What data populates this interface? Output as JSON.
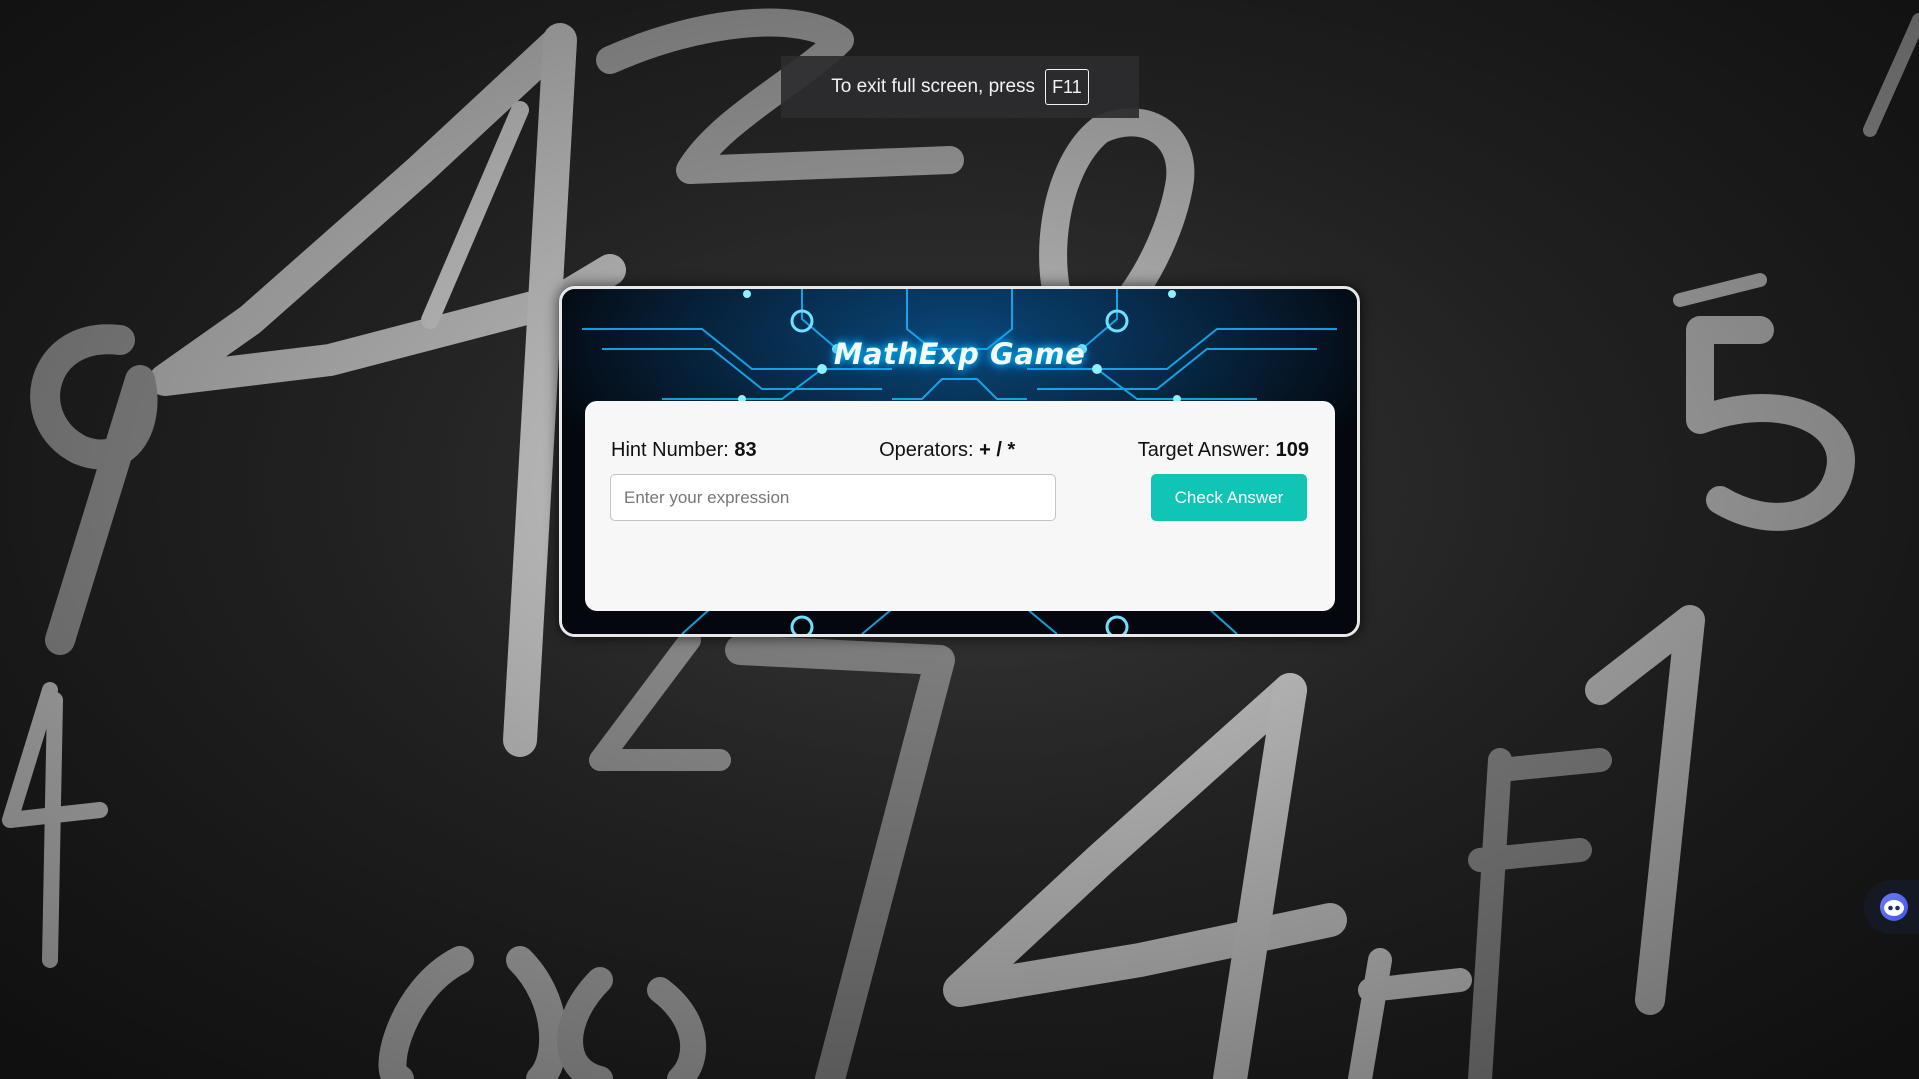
{
  "fullscreen_notice": {
    "text": "To exit full screen, press",
    "key": "F11"
  },
  "game": {
    "title": "MathExp Game",
    "hint_label": "Hint Number:",
    "hint_value": "83",
    "operators_label": "Operators:",
    "operators_value": "+ / *",
    "target_label": "Target Answer:",
    "target_value": "109",
    "input_placeholder": "Enter your expression",
    "input_value": "",
    "check_button_label": "Check Answer"
  },
  "background": {
    "decorative_digits": [
      "4",
      "2",
      "0",
      "9",
      "4",
      "4",
      "5",
      "4",
      "1",
      "0",
      "9",
      "7",
      "4",
      "5"
    ]
  },
  "colors": {
    "accent": "#11c5b4",
    "circuit_glow": "#14b8ff",
    "panel_background": "#f7f7f7"
  },
  "icons": {
    "assistant": "assistant-face-icon"
  }
}
